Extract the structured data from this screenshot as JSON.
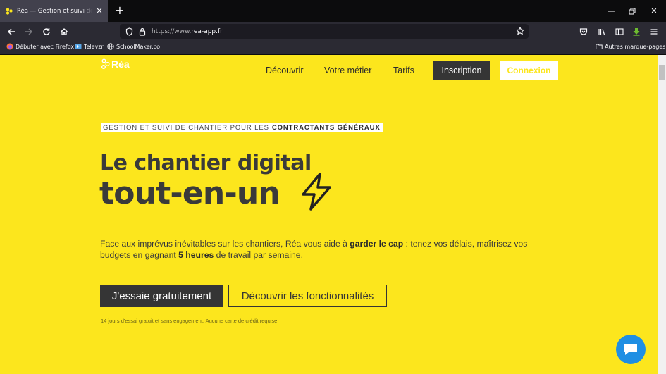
{
  "browser": {
    "tab_title": "Réa — Gestion et suivi de chantier",
    "url_prefix": "https://www.",
    "url_domain": "rea-app.fr",
    "bookmarks": [
      {
        "label": "Débuter avec Firefox"
      },
      {
        "label": "Televzr"
      },
      {
        "label": "SchoolMaker.co"
      }
    ],
    "other_bookmarks": "Autres marque-pages"
  },
  "site": {
    "logo": "Réa",
    "nav": {
      "discover": "Découvrir",
      "job": "Votre métier",
      "pricing": "Tarifs",
      "signup": "Inscription",
      "login": "Connexion"
    },
    "tagline_prefix": "GESTION ET SUIVI DE CHANTIER POUR LES",
    "tagline_bold": "CONTRACTANTS GÉNÉRAUX",
    "headline_1": "Le chantier digital",
    "headline_2": "tout-en-un",
    "desc": {
      "p1": "Face aux imprévus inévitables sur les chantiers, Réa vous aide à ",
      "b1": "garder le cap",
      "p2": " : tenez vos délais, maîtrisez vos budgets en gagnant ",
      "b2": "5 heures",
      "p3": " de travail par semaine."
    },
    "cta_try": "J'essaie gratuitement",
    "cta_features": "Découvrir les fonctionnalités",
    "fine_print": "14 jours d'essai gratuit et sans engagement. Aucune carte de crédit requise."
  },
  "colors": {
    "brand_yellow": "#fce61d",
    "dark": "#353535",
    "chat_blue": "#1f8fe3"
  }
}
